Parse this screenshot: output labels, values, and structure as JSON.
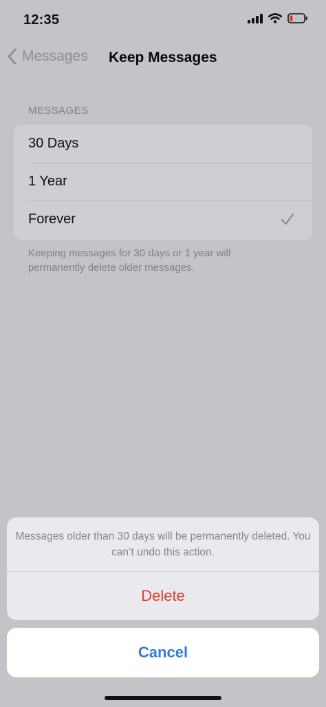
{
  "status_bar": {
    "time": "12:35",
    "icons": [
      "cellular-signal-icon",
      "wifi-icon",
      "battery-icon"
    ]
  },
  "nav": {
    "back_label": "Messages",
    "title": "Keep Messages"
  },
  "section": {
    "header": "MESSAGES",
    "options": [
      {
        "label": "30 Days",
        "selected": false
      },
      {
        "label": "1 Year",
        "selected": false
      },
      {
        "label": "Forever",
        "selected": true
      }
    ],
    "footer": "Keeping messages for 30 days or 1 year will permanently delete older messages."
  },
  "action_sheet": {
    "message": "Messages older than 30 days will be permanently deleted. You can’t undo this action.",
    "delete_label": "Delete",
    "cancel_label": "Cancel"
  },
  "colors": {
    "destructive": "#e23b34",
    "accent": "#2f7bde"
  }
}
